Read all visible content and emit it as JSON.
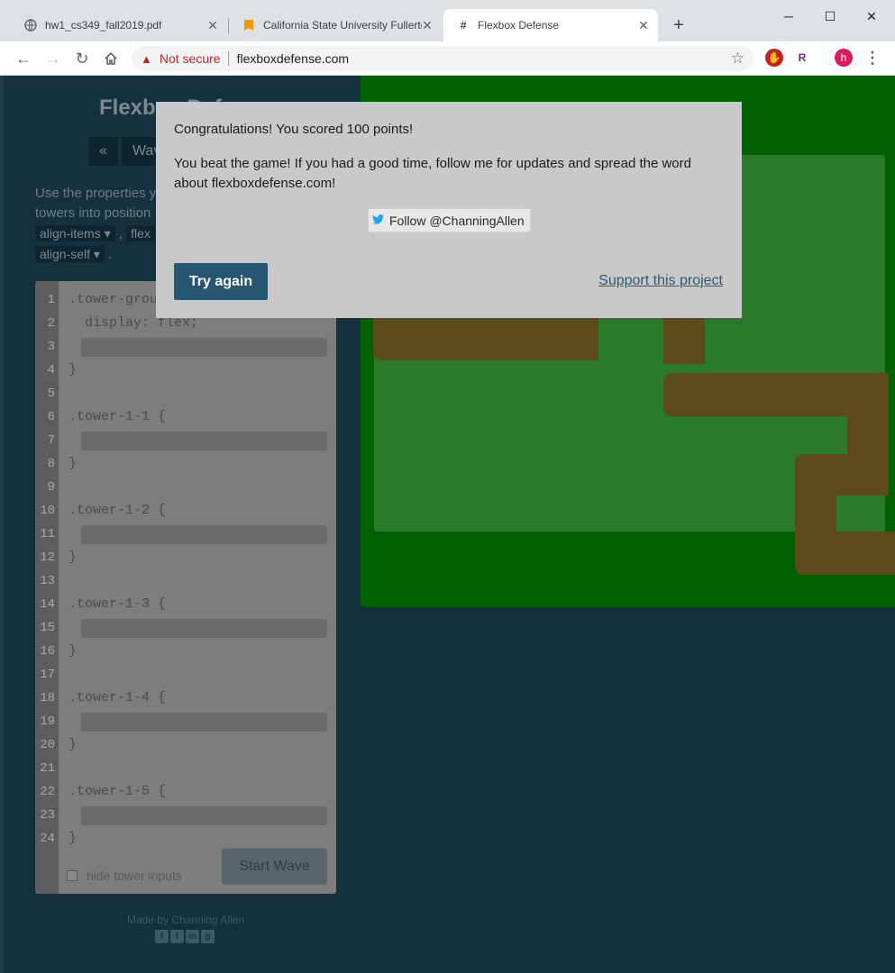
{
  "tabs": [
    {
      "label": "hw1_cs349_fall2019.pdf",
      "icon": "globe-icon"
    },
    {
      "label": "California State University Fullerto",
      "icon": "bookmark-icon"
    },
    {
      "label": "Flexbox Defense",
      "icon": "hash-icon"
    }
  ],
  "window_controls": {
    "minimize": "─",
    "maximize": "☐",
    "close": "✕"
  },
  "address_bar": {
    "security_label": "Not secure",
    "url": "flexboxdefense.com"
  },
  "profile_initial": "h",
  "extension_r": "R",
  "page": {
    "title": "Flexbox Defense",
    "prev_wave": "«",
    "wave_label": "Wave",
    "instructions_start": "Use the properties y",
    "instructions_line2": "towers into position",
    "pill_align_items": "align-items ▾",
    "pill_flex": "flex",
    "pill_align_self": "align-self ▾",
    "comma": ",",
    "period": ".",
    "hide_inputs_label": "hide tower inputs",
    "start_wave_label": "Start Wave",
    "credits": "Made by Channing Allen",
    "social_icons": [
      "facebook-icon",
      "twitter-icon",
      "linkedin-icon",
      "github-icon"
    ]
  },
  "editor_lines": [
    {
      "n": "1",
      "code": ".tower-group"
    },
    {
      "n": "2",
      "code": "  display: flex;"
    },
    {
      "n": "3",
      "code": "",
      "input": true
    },
    {
      "n": "4",
      "code": "}"
    },
    {
      "n": "5",
      "code": ""
    },
    {
      "n": "6",
      "code": ".tower-1-1 {"
    },
    {
      "n": "7",
      "code": "",
      "input": true
    },
    {
      "n": "8",
      "code": "}"
    },
    {
      "n": "9",
      "code": ""
    },
    {
      "n": "10",
      "code": ".tower-1-2 {"
    },
    {
      "n": "11",
      "code": "",
      "input": true
    },
    {
      "n": "12",
      "code": "}"
    },
    {
      "n": "13",
      "code": ""
    },
    {
      "n": "14",
      "code": ".tower-1-3 {"
    },
    {
      "n": "15",
      "code": "",
      "input": true
    },
    {
      "n": "16",
      "code": "}"
    },
    {
      "n": "17",
      "code": ""
    },
    {
      "n": "18",
      "code": ".tower-1-4 {"
    },
    {
      "n": "19",
      "code": "",
      "input": true
    },
    {
      "n": "20",
      "code": "}"
    },
    {
      "n": "21",
      "code": ""
    },
    {
      "n": "22",
      "code": ".tower-1-5 {"
    },
    {
      "n": "23",
      "code": "",
      "input": true
    },
    {
      "n": "24",
      "code": "}"
    }
  ],
  "modal": {
    "message": "Congratulations! You scored 100 points!",
    "beat_game": "You beat the game! If you had a good time, follow me for updates and spread the word about flexboxdefense.com!",
    "follow_label": "Follow @ChanningAllen",
    "try_again_label": "Try again",
    "support_label": "Support this project"
  },
  "colors": {
    "page_bg": "#15313f",
    "board_green": "#006100",
    "path_brown": "#5c4a1d",
    "modal_bg": "#c9c9c9",
    "primary_button": "#275770"
  }
}
